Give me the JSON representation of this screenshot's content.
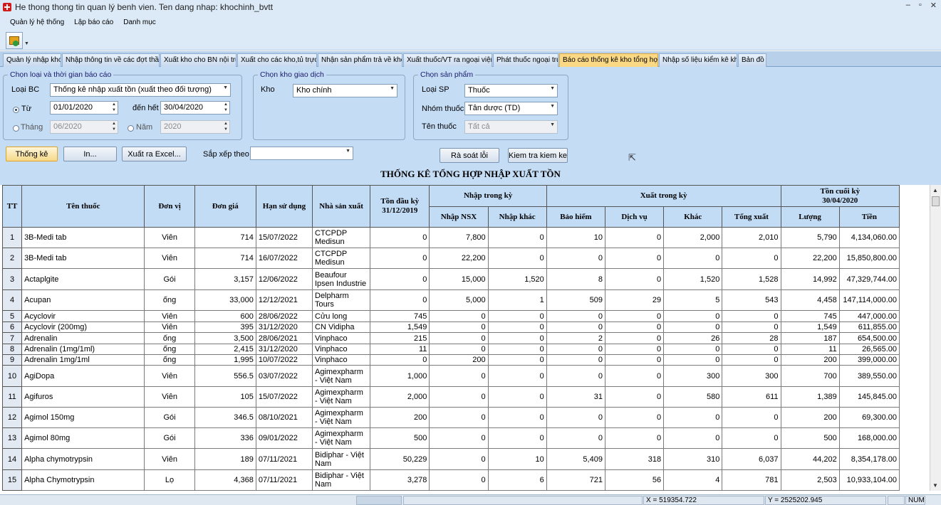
{
  "window": {
    "title": "He thong thong tin quan lý benh vien. Ten dang nhap: khochinh_bvtt",
    "min": "–",
    "restore": "▫",
    "close": "✕"
  },
  "menu": [
    "Quản lý hệ thống",
    "Lập báo cáo",
    "Danh mục"
  ],
  "tabs": [
    {
      "label": "Quản lý nhập kho",
      "active": false
    },
    {
      "label": "Nhập thông tin về các đợt thầu",
      "active": false
    },
    {
      "label": "Xuất kho cho BN nội trú",
      "active": false
    },
    {
      "label": "Xuất cho các kho,tủ trực",
      "active": false
    },
    {
      "label": "Nhận sản phẩm trả về kho",
      "active": false
    },
    {
      "label": "Xuất thuốc/VT ra ngoại viện",
      "active": false
    },
    {
      "label": "Phát thuốc ngoại trú",
      "active": false
    },
    {
      "label": "Báo cáo thống kê kho tổng hợp",
      "active": true
    },
    {
      "label": "Nhập số liệu kiểm kê kho",
      "active": false
    },
    {
      "label": "Bản đồ",
      "active": false
    }
  ],
  "group1": {
    "legend": "Chọn loại và thời gian báo cáo",
    "loai_bc_label": "Loại BC",
    "loai_bc_value": "Thống kê nhập xuất tồn (xuất theo đối tượng)",
    "tu_label": "Từ",
    "tu_value": "01/01/2020",
    "den_het_label": "đến hết",
    "den_het_value": "30/04/2020",
    "thang_label": "Tháng",
    "thang_value": "06/2020",
    "nam_label": "Năm",
    "nam_value": "2020"
  },
  "group2": {
    "legend": "Chọn kho giao dịch",
    "kho_label": "Kho",
    "kho_value": "Kho chính"
  },
  "group3": {
    "legend": "Chọn sản phẩm",
    "loai_sp_label": "Loại SP",
    "loai_sp_value": "Thuốc",
    "nhom_thuoc_label": "Nhóm thuốc",
    "nhom_thuoc_value": "Tân dược (TD)",
    "ten_thuoc_label": "Tên thuốc",
    "ten_thuoc_value": "Tất cả"
  },
  "actions": {
    "thong_ke": "Thống kê",
    "in": "In...",
    "xuat_excel": "Xuất ra Excel...",
    "sap_xep_label": "Sắp xếp theo",
    "sap_xep_value": "",
    "ra_soat": "Rà soát lỗi",
    "kiem_tra": "Kiem tra kiem ke"
  },
  "report_title": "THỐNG KÊ TỔNG HỢP NHẬP XUẤT TỒN",
  "table": {
    "headers": {
      "tt": "TT",
      "ten_thuoc": "Tên thuốc",
      "don_vi": "Đơn vị",
      "don_gia": "Đơn giá",
      "han_su_dung": "Hạn sử dụng",
      "nha_san_xuat": "Nhà sản xuất",
      "ton_dau_ky": "Tồn đầu kỳ",
      "ton_dau_ky_date": "31/12/2019",
      "nhap_trong_ky": "Nhập trong kỳ",
      "nhap_nsx": "Nhập NSX",
      "nhap_khac": "Nhập khác",
      "xuat_trong_ky": "Xuất trong kỳ",
      "bao_hiem": "Bảo hiểm",
      "dich_vu": "Dịch vụ",
      "khac": "Khác",
      "tong_xuat": "Tổng xuất",
      "ton_cuoi_ky": "Tồn cuối kỳ",
      "ton_cuoi_ky_date": "30/04/2020",
      "luong": "Lượng",
      "tien": "Tiền"
    },
    "rows": [
      {
        "tt": "1",
        "ten": "3B-Medi tab",
        "dv": "Viên",
        "gia": "714",
        "hsd": "15/07/2022",
        "nsx": "CTCPDP Medisun",
        "tdk": "0",
        "nnsx": "7,800",
        "nk": "0",
        "bh": "10",
        "dvu": "0",
        "kh": "2,000",
        "tx": "2,010",
        "luong": "5,790",
        "tien": "4,134,060.00",
        "h": 29
      },
      {
        "tt": "2",
        "ten": "3B-Medi tab",
        "dv": "Viên",
        "gia": "714",
        "hsd": "16/07/2022",
        "nsx": "CTCPDP Medisun",
        "tdk": "0",
        "nnsx": "22,200",
        "nk": "0",
        "bh": "0",
        "dvu": "0",
        "kh": "0",
        "tx": "0",
        "luong": "22,200",
        "tien": "15,850,800.00",
        "h": 29
      },
      {
        "tt": "3",
        "ten": "Actaplgite",
        "dv": "Gói",
        "gia": "3,157",
        "hsd": "12/06/2022",
        "nsx": "Beaufour Ipsen Industrie",
        "tdk": "0",
        "nnsx": "15,000",
        "nk": "1,520",
        "bh": "8",
        "dvu": "0",
        "kh": "1,520",
        "tx": "1,528",
        "luong": "14,992",
        "tien": "47,329,744.00",
        "h": 30
      },
      {
        "tt": "4",
        "ten": "Acupan",
        "dv": "ống",
        "gia": "33,000",
        "hsd": "12/12/2021",
        "nsx": "Delpharm Tours",
        "tdk": "0",
        "nnsx": "5,000",
        "nk": "1",
        "bh": "509",
        "dvu": "29",
        "kh": "5",
        "tx": "543",
        "luong": "4,458",
        "tien": "147,114,000.00",
        "h": 29
      },
      {
        "tt": "5",
        "ten": "Acyclovir",
        "dv": "Viên",
        "gia": "600",
        "hsd": "28/06/2022",
        "nsx": "Cửu long",
        "tdk": "745",
        "nnsx": "0",
        "nk": "0",
        "bh": "0",
        "dvu": "0",
        "kh": "0",
        "tx": "0",
        "luong": "745",
        "tien": "447,000.00",
        "h": 16
      },
      {
        "tt": "6",
        "ten": "Acyclovir (200mg)",
        "dv": "Viên",
        "gia": "395",
        "hsd": "31/12/2020",
        "nsx": "CN Vidipha",
        "tdk": "1,549",
        "nnsx": "0",
        "nk": "0",
        "bh": "0",
        "dvu": "0",
        "kh": "0",
        "tx": "0",
        "luong": "1,549",
        "tien": "611,855.00",
        "h": 15
      },
      {
        "tt": "7",
        "ten": "Adrenalin",
        "dv": "ống",
        "gia": "3,500",
        "hsd": "28/06/2021",
        "nsx": "Vinphaco",
        "tdk": "215",
        "nnsx": "0",
        "nk": "0",
        "bh": "2",
        "dvu": "0",
        "kh": "26",
        "tx": "28",
        "luong": "187",
        "tien": "654,500.00",
        "h": 16
      },
      {
        "tt": "8",
        "ten": "Adrenalin (1mg/1ml)",
        "dv": "ống",
        "gia": "2,415",
        "hsd": "31/12/2020",
        "nsx": "Vinphaco",
        "tdk": "11",
        "nnsx": "0",
        "nk": "0",
        "bh": "0",
        "dvu": "0",
        "kh": "0",
        "tx": "0",
        "luong": "11",
        "tien": "26,565.00",
        "h": 15
      },
      {
        "tt": "9",
        "ten": "Adrenalin 1mg/1ml",
        "dv": "ống",
        "gia": "1,995",
        "hsd": "10/07/2022",
        "nsx": "Vinphaco",
        "tdk": "0",
        "nnsx": "200",
        "nk": "0",
        "bh": "0",
        "dvu": "0",
        "kh": "0",
        "tx": "0",
        "luong": "200",
        "tien": "399,000.00",
        "h": 15
      },
      {
        "tt": "10",
        "ten": "AgiDopa",
        "dv": "Viên",
        "gia": "556.5",
        "hsd": "03/07/2022",
        "nsx": "Agimexpharm - Việt Nam",
        "tdk": "1,000",
        "nnsx": "0",
        "nk": "0",
        "bh": "0",
        "dvu": "0",
        "kh": "300",
        "tx": "300",
        "luong": "700",
        "tien": "389,550.00",
        "h": 30
      },
      {
        "tt": "11",
        "ten": "Agifuros",
        "dv": "Viên",
        "gia": "105",
        "hsd": "15/07/2022",
        "nsx": "Agimexpharm - Việt Nam",
        "tdk": "2,000",
        "nnsx": "0",
        "nk": "0",
        "bh": "31",
        "dvu": "0",
        "kh": "580",
        "tx": "611",
        "luong": "1,389",
        "tien": "145,845.00",
        "h": 29
      },
      {
        "tt": "12",
        "ten": "Agimol 150mg",
        "dv": "Gói",
        "gia": "346.5",
        "hsd": "08/10/2021",
        "nsx": "Agimexpharm - Việt Nam",
        "tdk": "200",
        "nnsx": "0",
        "nk": "0",
        "bh": "0",
        "dvu": "0",
        "kh": "0",
        "tx": "0",
        "luong": "200",
        "tien": "69,300.00",
        "h": 29
      },
      {
        "tt": "13",
        "ten": "Agimol 80mg",
        "dv": "Gói",
        "gia": "336",
        "hsd": "09/01/2022",
        "nsx": "Agimexpharm - Việt Nam",
        "tdk": "500",
        "nnsx": "0",
        "nk": "0",
        "bh": "0",
        "dvu": "0",
        "kh": "0",
        "tx": "0",
        "luong": "500",
        "tien": "168,000.00",
        "h": 29
      },
      {
        "tt": "14",
        "ten": "Alpha chymotrypsin",
        "dv": "Viên",
        "gia": "189",
        "hsd": "07/11/2021",
        "nsx": "Bidiphar - Việt Nam",
        "tdk": "50,229",
        "nnsx": "0",
        "nk": "10",
        "bh": "5,409",
        "dvu": "318",
        "kh": "310",
        "tx": "6,037",
        "luong": "44,202",
        "tien": "8,354,178.00",
        "h": 30
      },
      {
        "tt": "15",
        "ten": "Alpha Chymotrypsin",
        "dv": "Lọ",
        "gia": "4,368",
        "hsd": "07/11/2021",
        "nsx": "Bidiphar - Việt Nam",
        "tdk": "3,278",
        "nnsx": "0",
        "nk": "6",
        "bh": "721",
        "dvu": "56",
        "kh": "4",
        "tx": "781",
        "luong": "2,503",
        "tien": "10,933,104.00",
        "h": 29
      }
    ]
  },
  "status": {
    "x": "X = 519354.722",
    "y": "Y = 2525202.945",
    "num": "NUM"
  }
}
